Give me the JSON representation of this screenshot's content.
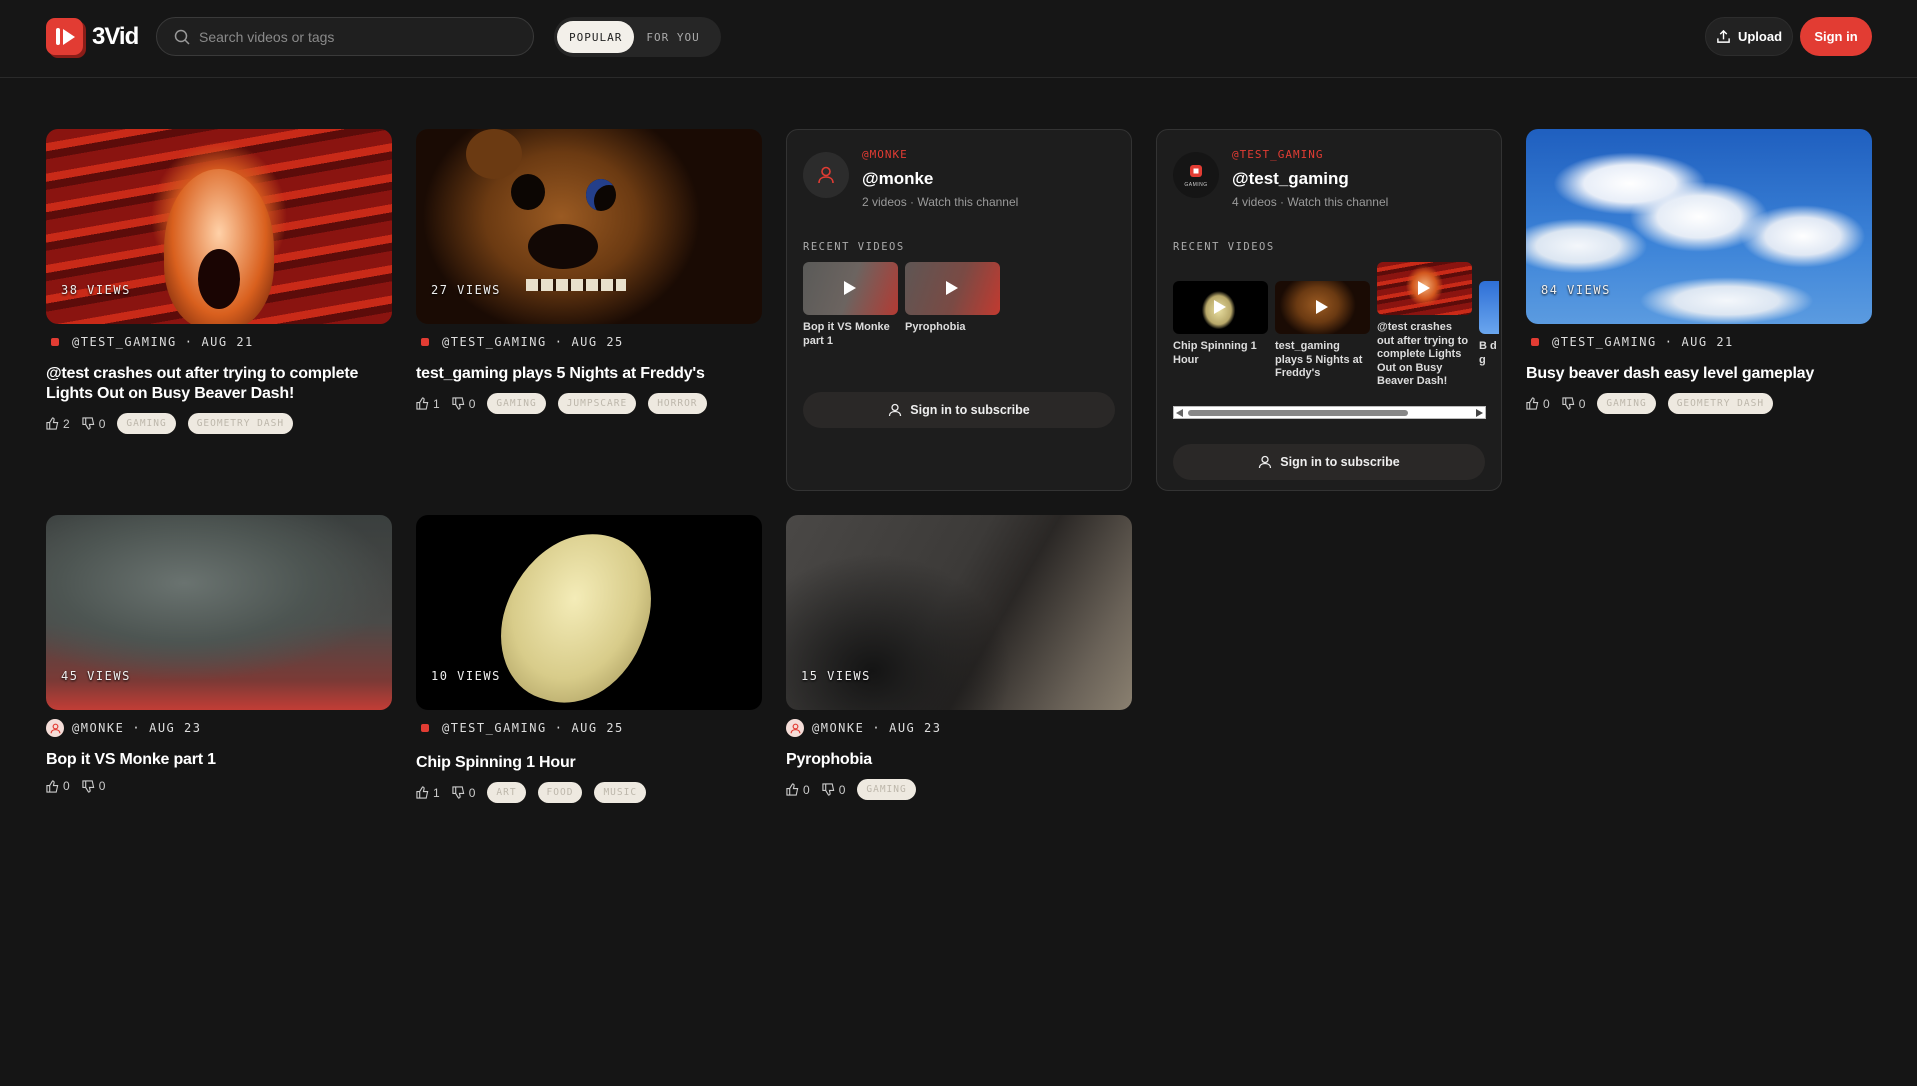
{
  "app": {
    "name": "3Vid"
  },
  "search": {
    "placeholder": "Search videos or tags"
  },
  "tabs": [
    {
      "label": "POPULAR",
      "active": true
    },
    {
      "label": "FOR YOU",
      "active": false
    }
  ],
  "actions": {
    "upload": "Upload",
    "sign_in": "Sign in"
  },
  "colors": {
    "accent": "#e23c33",
    "background": "#151515",
    "card": "#1d1d1d"
  },
  "videos": [
    {
      "views": "38 VIEWS",
      "channel": "@TEST_GAMING",
      "date": "AUG 21",
      "title": "@test crashes out after trying to complete Lights Out on Busy Beaver Dash!",
      "likes": "2",
      "dislikes": "0",
      "tags": [
        "GAMING",
        "GEOMETRY DASH"
      ]
    },
    {
      "views": "27 VIEWS",
      "channel": "@TEST_GAMING",
      "date": "AUG 25",
      "title": "test_gaming plays 5 Nights at Freddy's",
      "likes": "1",
      "dislikes": "0",
      "tags": [
        "GAMING",
        "JUMPSCARE",
        "HORROR"
      ]
    },
    {
      "views": "84 VIEWS",
      "channel": "@TEST_GAMING",
      "date": "AUG 21",
      "title": "Busy beaver dash easy level gameplay",
      "likes": "0",
      "dislikes": "0",
      "tags": [
        "GAMING",
        "GEOMETRY DASH"
      ]
    },
    {
      "views": "45 VIEWS",
      "channel": "@MONKE",
      "date": "AUG 23",
      "title": "Bop it VS Monke part 1",
      "likes": "0",
      "dislikes": "0",
      "tags": []
    },
    {
      "views": "10 VIEWS",
      "channel": "@TEST_GAMING",
      "date": "AUG 25",
      "title": "Chip Spinning 1 Hour",
      "likes": "1",
      "dislikes": "0",
      "tags": [
        "ART",
        "FOOD",
        "MUSIC"
      ]
    },
    {
      "views": "15 VIEWS",
      "channel": "@MONKE",
      "date": "AUG 23",
      "title": "Pyrophobia",
      "likes": "0",
      "dislikes": "0",
      "tags": [
        "GAMING"
      ]
    }
  ],
  "channels": [
    {
      "handle": "@MONKE",
      "name": "@monke",
      "sub": "2 videos · Watch this channel",
      "recent_label": "RECENT VIDEOS",
      "recent": [
        "Bop it VS Monke part 1",
        "Pyrophobia"
      ],
      "subscribe": "Sign in to subscribe"
    },
    {
      "handle": "@TEST_GAMING",
      "name": "@test_gaming",
      "sub": "4 videos · Watch this channel",
      "recent_label": "RECENT VIDEOS",
      "recent": [
        "Chip Spinning 1 Hour",
        "test_gaming plays 5 Nights at Freddy's",
        "@test crashes out after trying to complete Lights Out on Busy Beaver Dash!",
        "B d g"
      ],
      "subscribe": "Sign in to subscribe",
      "avatar_label": "GAMING"
    }
  ]
}
